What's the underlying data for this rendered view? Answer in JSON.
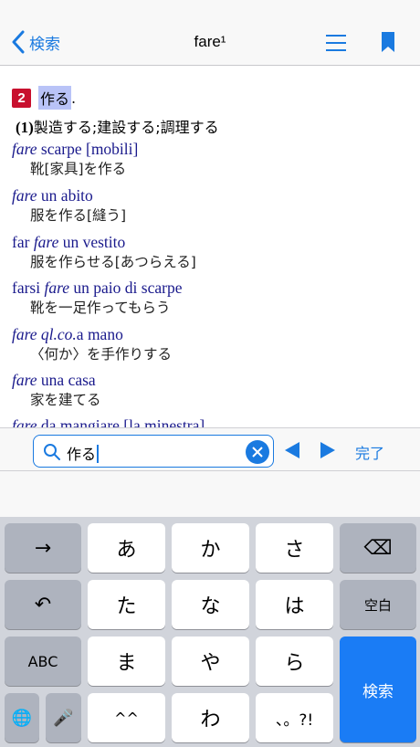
{
  "nav": {
    "back_label": "検索",
    "title": "fare¹"
  },
  "entry": {
    "sense_number": "2",
    "sense_headword": "作る",
    "sense_period": ".",
    "sub_number": "(1)",
    "sub_meaning": "製造する;建設する;調理する",
    "examples": [
      {
        "it_pre": "",
        "it_italic": "fare",
        "it_post": " scarpe [mobili]",
        "jp": "靴[家具]を作る"
      },
      {
        "it_pre": "",
        "it_italic": "fare",
        "it_post": " un abito",
        "jp": "服を作る[縫う]"
      },
      {
        "it_pre": "far ",
        "it_italic": "fare",
        "it_post": " un vestito",
        "jp": "服を作らせる[あつらえる]"
      },
      {
        "it_pre": "farsi ",
        "it_italic": "fare",
        "it_post": " un paio di scarpe",
        "jp": "靴を一足作ってもらう"
      },
      {
        "it_pre": "",
        "it_italic": "fare ql.co.",
        "it_post": "a mano",
        "jp": "〈何か〉を手作りする"
      },
      {
        "it_pre": "",
        "it_italic": "fare",
        "it_post": " una casa",
        "jp": "家を建てる"
      },
      {
        "it_pre": "",
        "it_italic": "fare",
        "it_post": " da mangiare [la minestra]",
        "jp": ""
      }
    ]
  },
  "search": {
    "value": "作る",
    "done_label": "完了"
  },
  "keyboard": {
    "row1": [
      "→",
      "あ",
      "か",
      "さ",
      "⌫"
    ],
    "row2": [
      "↶",
      "た",
      "な",
      "は",
      "空白"
    ],
    "row3": [
      "ABC",
      "ま",
      "や",
      "ら"
    ],
    "row4": [
      "🌐",
      "🎤",
      "^^",
      "わ",
      "、。?!"
    ],
    "search_key": "検索"
  }
}
